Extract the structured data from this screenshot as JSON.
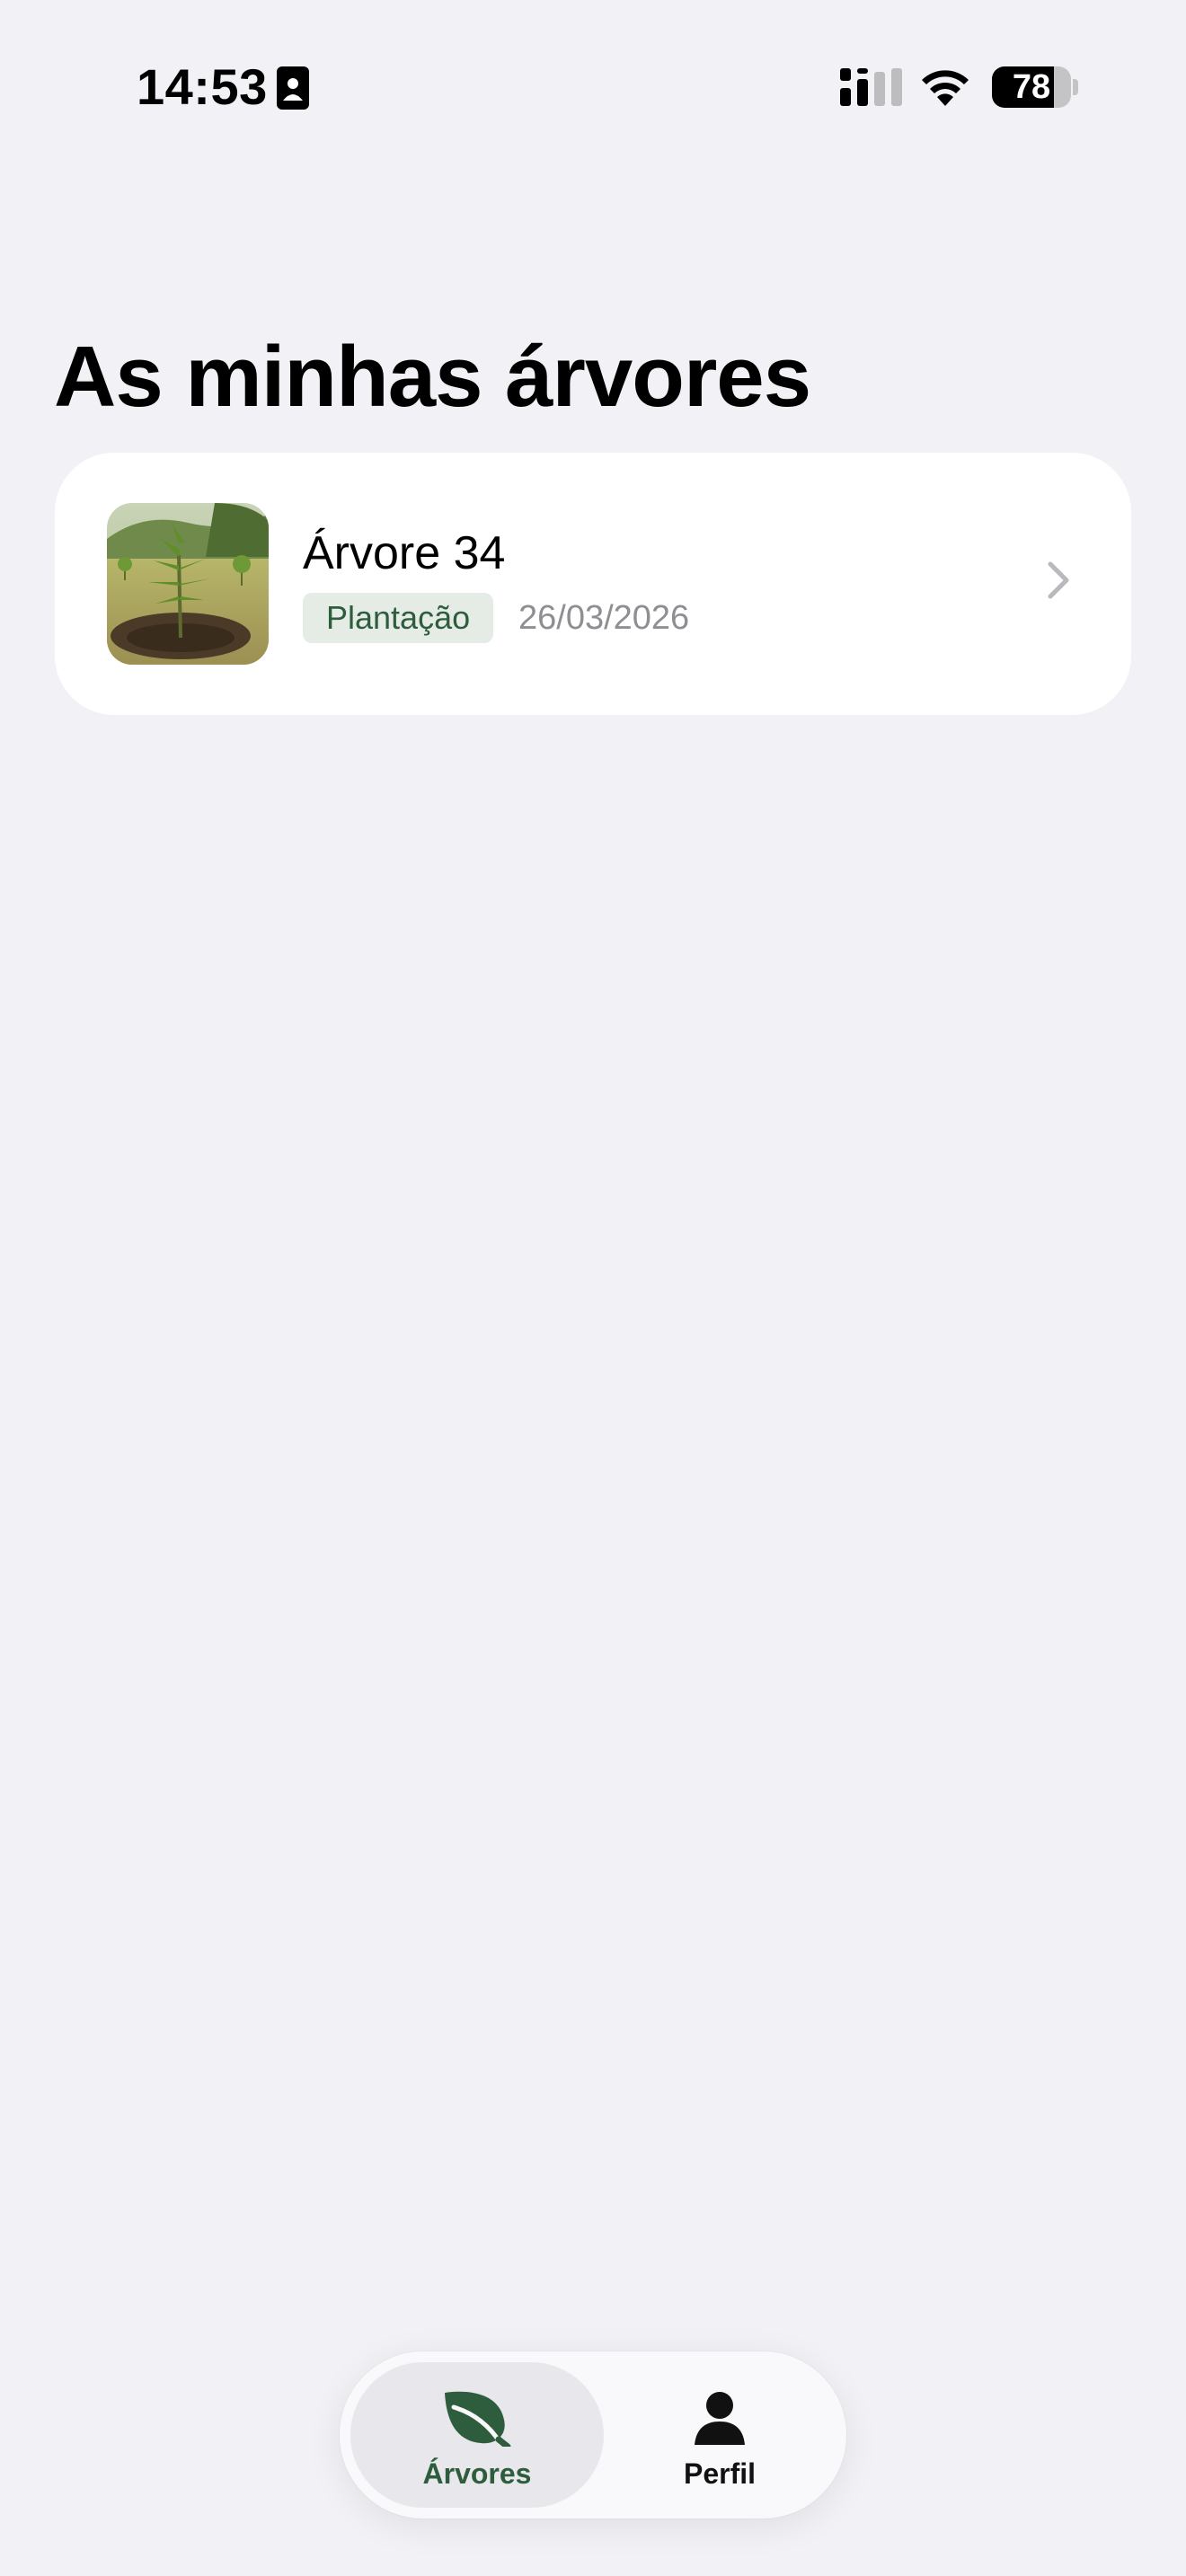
{
  "status_bar": {
    "time": "14:53",
    "battery_level": "78",
    "battery_fraction": 0.78
  },
  "page": {
    "title": "As minhas árvores"
  },
  "trees": [
    {
      "name": "Árvore 34",
      "stage": "Plantação",
      "date": "26/03/2026",
      "thumbnail": "sapling-photo"
    }
  ],
  "tab_bar": {
    "tabs": [
      {
        "label": "Árvores",
        "icon": "leaf-icon",
        "active": true
      },
      {
        "label": "Perfil",
        "icon": "person-icon",
        "active": false
      }
    ]
  },
  "colors": {
    "background": "#f2f1f6",
    "accent_green": "#2e5d3d",
    "badge_background": "#e5ece6",
    "secondary_text": "#8e8e93"
  }
}
